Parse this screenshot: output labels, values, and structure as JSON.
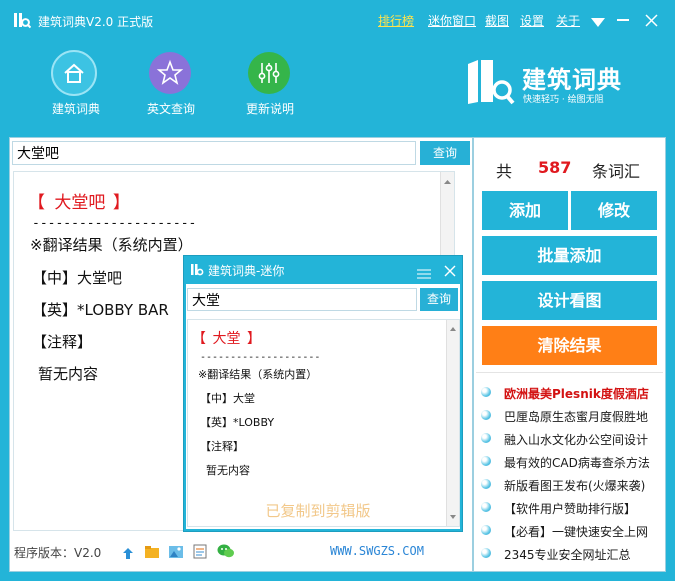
{
  "window": {
    "title": "建筑词典V2.0 正式版",
    "links": [
      "排行榜",
      "迷你窗口",
      "截图",
      "设置",
      "关于"
    ]
  },
  "nav": {
    "items": [
      {
        "label": "建筑词典",
        "icon": "home-icon"
      },
      {
        "label": "英文查询",
        "icon": "star-icon"
      },
      {
        "label": "更新说明",
        "icon": "sliders-icon"
      }
    ]
  },
  "logo": {
    "title": "建筑词典",
    "slogan": "快速轻巧 · 绘图无阻"
  },
  "search": {
    "value": "大堂吧",
    "button": "查询"
  },
  "result": {
    "open_bracket": "【",
    "term": "大堂吧",
    "close_bracket": "】",
    "divider": "---------------------",
    "source": "※翻译结果（系统内置）",
    "zh": "【中】大堂吧",
    "en": "【英】*LOBBY BAR",
    "note_label": "【注释】",
    "note": "暂无内容"
  },
  "stats": {
    "prefix": "共",
    "count": "587",
    "suffix": "条词汇"
  },
  "actions": {
    "add": "添加",
    "edit": "修改",
    "batch_add": "批量添加",
    "design": "设计看图",
    "clear": "清除结果"
  },
  "links": [
    "欧洲最美Plesnik度假酒店",
    "巴厘岛原生态蜜月度假胜地",
    "融入山水文化办公空间设计",
    "最有效的CAD病毒查杀方法",
    "新版看图王发布(火爆来袭)",
    "【软件用户赞助排行版】",
    "【必看】一键快速安全上网",
    "2345专业安全网址汇总"
  ],
  "footer": {
    "version": "程序版本：V2.0",
    "site": "WWW.SWGZS.COM"
  },
  "mini": {
    "title": "建筑词典-迷你",
    "search_value": "大堂",
    "button": "查询",
    "open_bracket": "【",
    "term": "大堂",
    "close_bracket": "】",
    "divider": "--------------------",
    "source": "※翻译结果（系统内置）",
    "zh": "【中】大堂",
    "en": "【英】*LOBBY",
    "note_label": "【注释】",
    "note": "暂无内容",
    "copied": "已复制到剪辑版"
  },
  "colors": {
    "primary": "#23b4d8",
    "orange": "#ff7f16",
    "red": "#e0191f",
    "highlight_link": "#ffe44d"
  }
}
